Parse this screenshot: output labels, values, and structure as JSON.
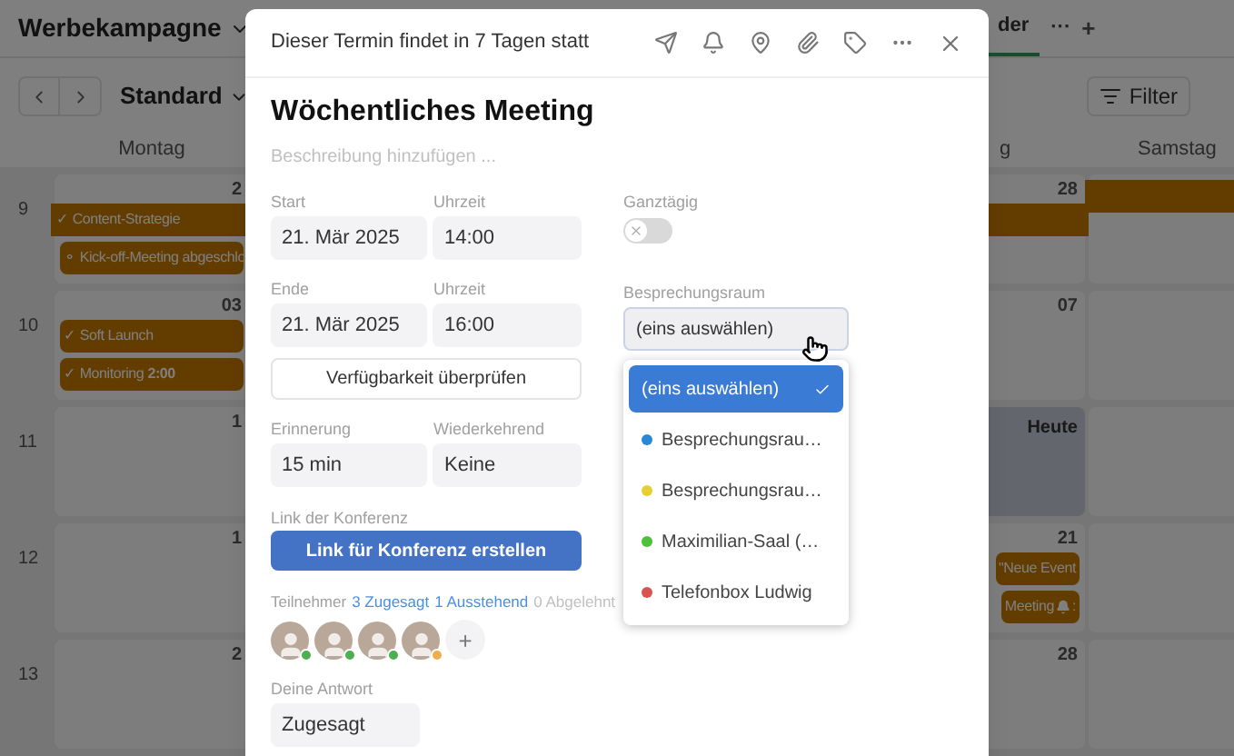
{
  "app": {
    "title": "Werbekampagne",
    "tabs": [
      {
        "label": "der",
        "selected": true
      }
    ],
    "tab_more": "···",
    "tab_add": "+",
    "view": "Standard",
    "filter": "Filter"
  },
  "calendar": {
    "week_numbers": [
      "9",
      "10",
      "11",
      "12",
      "13"
    ],
    "columns": [
      {
        "header": "Montag",
        "cells": [
          {
            "date": "2",
            "events": [
              {
                "kind": "span",
                "text": "✓ Content-Strategie"
              },
              {
                "kind": "event",
                "text": "⚬ Kick-off-Meeting abgeschlo"
              }
            ]
          },
          {
            "date": "03",
            "events": [
              {
                "kind": "event",
                "text": "✓ Soft Launch"
              },
              {
                "kind": "event",
                "text": "✓ Monitoring **2:00**"
              }
            ]
          },
          {
            "date": "1"
          },
          {
            "date": "1"
          },
          {
            "date": "2"
          }
        ]
      },
      {
        "header": "g",
        "cells": [
          {
            "date": "28",
            "events": [
              {
                "kind": "span"
              }
            ]
          },
          {
            "date": "07"
          },
          {
            "today": true,
            "label": "Heute"
          },
          {
            "date": "21",
            "events": [
              {
                "kind": "event",
                "text": "\"Neue Event"
              },
              {
                "kind": "event",
                "text": "Meeting",
                "bell": true,
                "after": ":"
              }
            ]
          },
          {
            "date": "28"
          }
        ]
      },
      {
        "header": "Samstag",
        "cells": [
          {
            "events": [
              {
                "kind": "span"
              }
            ]
          },
          {},
          {},
          {},
          {}
        ]
      }
    ]
  },
  "dialog": {
    "notice": "Dieser Termin findet in 7 Tagen statt",
    "title": "Wöchentliches Meeting",
    "description_placeholder": "Beschreibung hinzufügen ...",
    "start": {
      "label": "Start",
      "date": "21. Mär 2025",
      "time_label": "Uhrzeit",
      "time": "14:00"
    },
    "end": {
      "label": "Ende",
      "date": "21. Mär 2025",
      "time_label": "Uhrzeit",
      "time": "16:00"
    },
    "check_button": "Verfügbarkeit überprüfen",
    "reminder": {
      "label": "Erinnerung",
      "value": "15 min"
    },
    "recurring": {
      "label": "Wiederkehrend",
      "value": "Keine"
    },
    "conference": {
      "label": "Link der Konferenz",
      "button": "Link für Konferenz erstellen"
    },
    "participants": {
      "label": "Teilnehmer",
      "accepted": "3 Zugesagt",
      "pending": "1 Ausstehend",
      "declined": "0 Abgelehnt",
      "people": [
        {
          "accepted": true
        },
        {
          "accepted": true
        },
        {
          "accepted": true
        },
        {
          "accepted": false
        }
      ],
      "add": "+"
    },
    "response": {
      "label": "Deine Antwort",
      "value": "Zugesagt"
    },
    "all_day": {
      "label": "Ganztägig",
      "on": false
    },
    "room": {
      "label": "Besprechungsraum",
      "value": "(eins auswählen)",
      "expanded": true,
      "options": [
        {
          "label": "(eins auswählen)",
          "selected": true
        },
        {
          "label": "Besprechungsrau…",
          "color": "#2a86d6",
          "selected": false
        },
        {
          "label": "Besprechungsrau…",
          "color": "#e6cf30",
          "selected": false
        },
        {
          "label": "Maximilian-Saal (…",
          "color": "#4cc23a",
          "selected": false
        },
        {
          "label": "Telefonbox Ludwig",
          "color": "#d9534f",
          "selected": false
        }
      ]
    }
  }
}
